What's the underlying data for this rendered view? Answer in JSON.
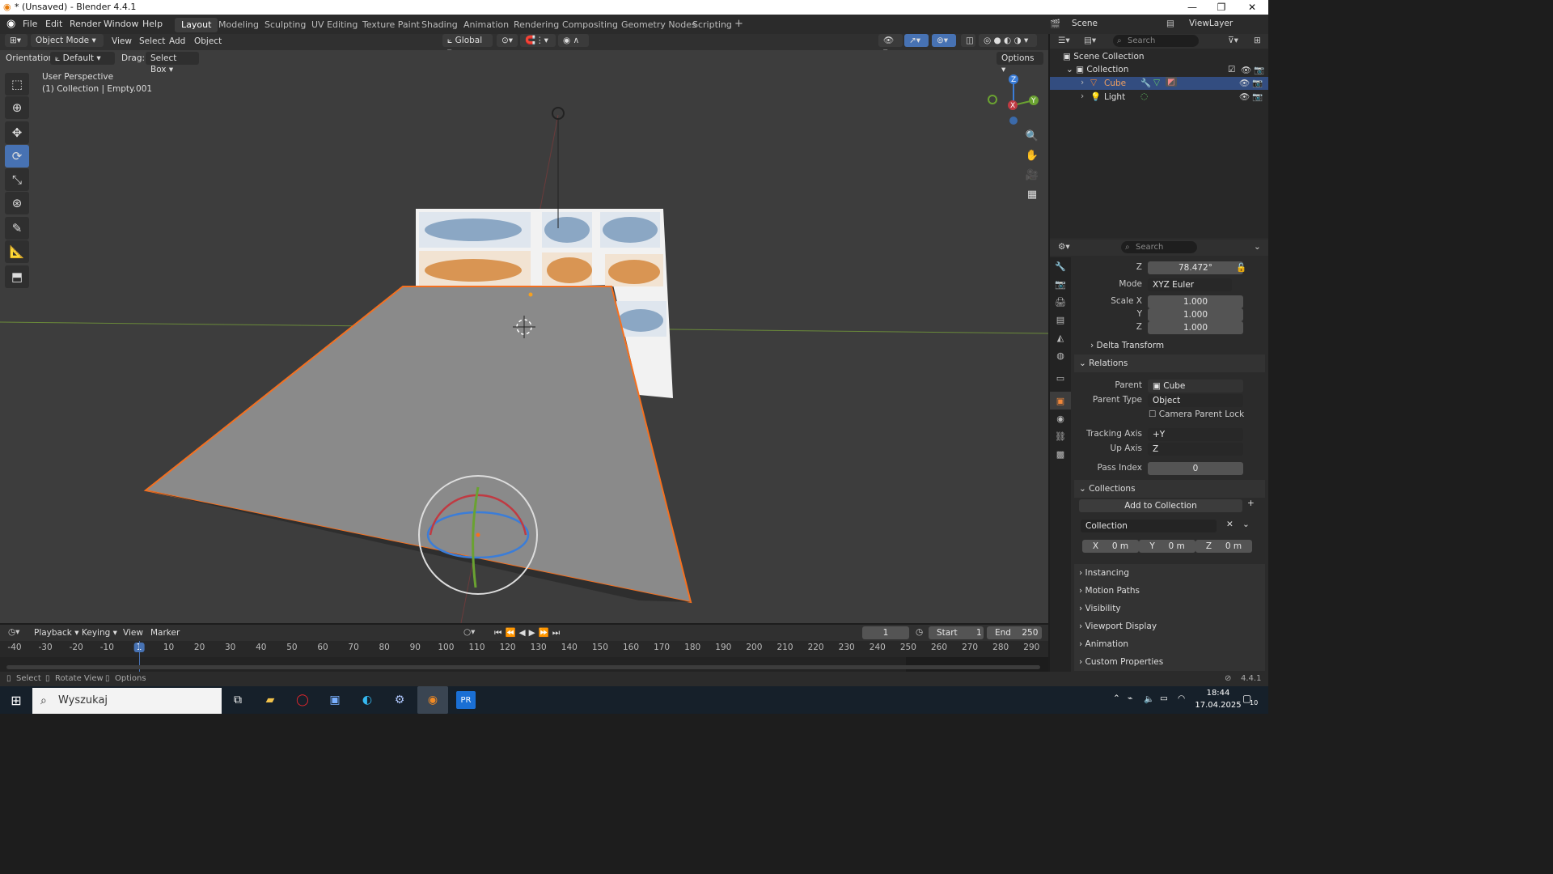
{
  "window": {
    "title": "* (Unsaved) - Blender 4.4.1",
    "minimize": "—",
    "maximize": "❐",
    "close": "✕"
  },
  "menu": {
    "items": [
      "File",
      "Edit",
      "Render",
      "Window",
      "Help"
    ],
    "workspaces": [
      "Layout",
      "Modeling",
      "Sculpting",
      "UV Editing",
      "Texture Paint",
      "Shading",
      "Animation",
      "Rendering",
      "Compositing",
      "Geometry Nodes",
      "Scripting"
    ],
    "active_workspace": "Layout",
    "add_workspace": "+",
    "scene_label": "Scene",
    "view_layer_label": "ViewLayer"
  },
  "viewport_header": {
    "mode": "Object Mode",
    "menus": [
      "View",
      "Select",
      "Add",
      "Object"
    ],
    "transform_orientation": "Global",
    "orientation_label": "Orientation:",
    "orientation_value": "Default",
    "drag_label": "Drag:",
    "drag_value": "Select Box",
    "options": "Options"
  },
  "viewport": {
    "perspective": "User Perspective",
    "collection_info": "(1) Collection | Empty.001",
    "gizmo_axes": {
      "z": "Z",
      "y": "Y",
      "x": "X"
    },
    "colors": {
      "background": "#3d3d3d",
      "plane": "#8a8a8a",
      "selection": "#f5701f",
      "x_axis": "#c03a42",
      "y_axis": "#6aa231",
      "z_axis": "#3b7dd8"
    }
  },
  "outliner": {
    "search_placeholder": "Search",
    "root": "Scene Collection",
    "collection": "Collection",
    "items": [
      {
        "name": "Cube",
        "selected": true
      },
      {
        "name": "Light",
        "selected": false
      }
    ]
  },
  "properties": {
    "search_placeholder": "Search",
    "rotation_z_label": "Z",
    "rotation_z": "78.472°",
    "mode_label": "Mode",
    "mode_value": "XYZ Euler",
    "scale_x_label": "Scale X",
    "scale_x": "1.000",
    "scale_y_label": "Y",
    "scale_y": "1.000",
    "scale_z_label": "Z",
    "scale_z": "1.000",
    "delta_transform": "Delta Transform",
    "relations": "Relations",
    "parent_label": "Parent",
    "parent_value": "Cube",
    "parent_type_label": "Parent Type",
    "parent_type_value": "Object",
    "camera_parent_lock": "Camera Parent Lock",
    "tracking_axis_label": "Tracking Axis",
    "tracking_axis_value": "+Y",
    "up_axis_label": "Up Axis",
    "up_axis_value": "Z",
    "pass_index_label": "Pass Index",
    "pass_index_value": "0",
    "collections": "Collections",
    "add_to_collection": "Add to Collection",
    "collection_name": "Collection",
    "offset": {
      "x_label": "X",
      "x": "0 m",
      "y_label": "Y",
      "y": "0 m",
      "z_label": "Z",
      "z": "0 m"
    },
    "sections": [
      "Instancing",
      "Motion Paths",
      "Visibility",
      "Viewport Display",
      "Animation",
      "Custom Properties"
    ]
  },
  "timeline": {
    "menus": [
      "Playback",
      "Keying",
      "View",
      "Marker"
    ],
    "current_frame": "1",
    "start_label": "Start",
    "start": "1",
    "end_label": "End",
    "end": "250",
    "ruler": [
      "-40",
      "-30",
      "-20",
      "-10",
      "1",
      "10",
      "20",
      "30",
      "40",
      "50",
      "60",
      "70",
      "80",
      "90",
      "100",
      "110",
      "120",
      "130",
      "140",
      "150",
      "160",
      "170",
      "180",
      "190",
      "200",
      "210",
      "220",
      "230",
      "240",
      "250",
      "260",
      "270",
      "280",
      "290"
    ]
  },
  "statusbar": {
    "select": "Select",
    "rotate": "Rotate View",
    "options": "Options",
    "version": "4.4.1"
  },
  "taskbar": {
    "search_text": "Wyszukaj",
    "time": "18:44",
    "date": "17.04.2025",
    "notifications": "10"
  }
}
